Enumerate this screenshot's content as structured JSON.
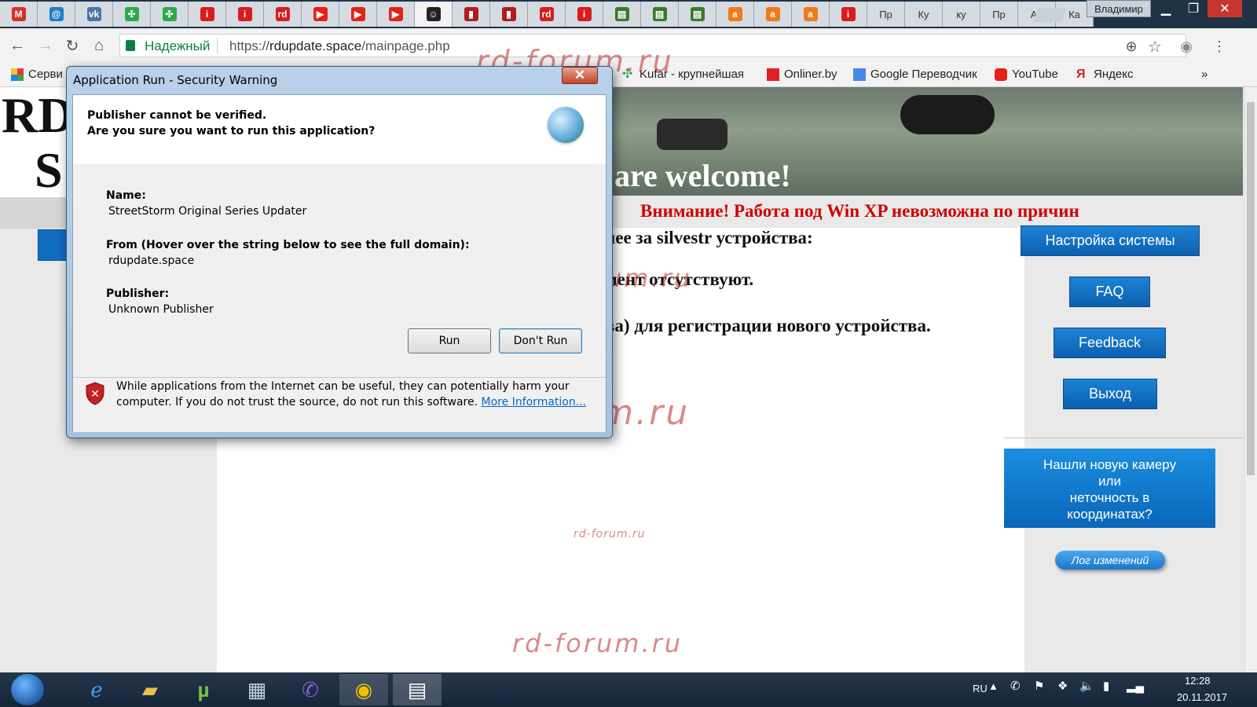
{
  "browser": {
    "tabs": [
      {
        "glyph": "M",
        "color": "#d93025"
      },
      {
        "glyph": "@",
        "color": "#1f7fc4"
      },
      {
        "glyph": "vk",
        "color": "#4a76a8"
      },
      {
        "glyph": "✣",
        "color": "#30a84a"
      },
      {
        "glyph": "✣",
        "color": "#30a84a"
      },
      {
        "glyph": "i",
        "color": "#d91c1c"
      },
      {
        "glyph": "i",
        "color": "#d91c1c"
      },
      {
        "glyph": "rd",
        "color": "#d91c1c"
      },
      {
        "glyph": "▶",
        "color": "#e62117"
      },
      {
        "glyph": "▶",
        "color": "#e62117"
      },
      {
        "glyph": "▶",
        "color": "#e62117"
      },
      {
        "glyph": "☺",
        "color": "#222222"
      },
      {
        "glyph": "▮",
        "color": "#b01c1c"
      },
      {
        "glyph": "▮",
        "color": "#b01c1c"
      },
      {
        "glyph": "rd",
        "color": "#d91c1c"
      },
      {
        "glyph": "i",
        "color": "#d91c1c"
      },
      {
        "glyph": "▤",
        "color": "#3a7a2a"
      },
      {
        "glyph": "▤",
        "color": "#3a7a2a"
      },
      {
        "glyph": "▤",
        "color": "#3a7a2a"
      },
      {
        "glyph": "a",
        "color": "#f07a1a"
      },
      {
        "glyph": "a",
        "color": "#f07a1a"
      },
      {
        "glyph": "a",
        "color": "#f07a1a"
      },
      {
        "glyph": "i",
        "color": "#d91c1c"
      },
      {
        "glyph": "Пр",
        "color": ""
      },
      {
        "glyph": "Ку",
        "color": ""
      },
      {
        "glyph": "ку",
        "color": ""
      },
      {
        "glyph": "Пр",
        "color": ""
      },
      {
        "glyph": "Ан",
        "color": ""
      },
      {
        "glyph": "Ка",
        "color": ""
      }
    ],
    "user_label": "Владимир",
    "secure_label": "Надежный",
    "url_scheme": "https://",
    "url_host": "rdupdate.space",
    "url_path": "/mainpage.php",
    "bookmarks": {
      "services": "Серви",
      "kufar": "Kufar - крупнейшая",
      "onliner": "Onliner.by",
      "translate": "Google Переводчик",
      "youtube": "YouTube",
      "yandex": "Яндекс",
      "more": "»"
    }
  },
  "site": {
    "logo_line1": "RD",
    "logo_line2": "S",
    "hero_text": "are welcome!",
    "warning_banner": "Внимание! Работа под Win XP невозможна по причин",
    "content_line1": "нее за silvestr устройства:",
    "content_line2": "мент отсутствуют.",
    "content_line3": "ва) для регистрации нового устройства.",
    "sidebar": {
      "system_settings": "Настройка системы",
      "faq": "FAQ",
      "feedback": "Feedback",
      "logout": "Выход",
      "camera_line1": "Нашли новую камеру",
      "camera_line2": "или",
      "camera_line3": "неточность в",
      "camera_line4": "координатах?",
      "changelog": "Лог изменений"
    },
    "watermark": "rd-forum.ru"
  },
  "dialog": {
    "title": "Application Run - Security Warning",
    "close": "✕",
    "heading1": "Publisher cannot be verified.",
    "heading2": "Are you sure you want to run this application?",
    "name_label": "Name:",
    "name_value": "StreetStorm Original Series Updater",
    "from_label": "From (Hover over the string below to see the full domain):",
    "from_value": "rdupdate.space",
    "publisher_label": "Publisher:",
    "publisher_value": "Unknown Publisher",
    "run_button": "Run",
    "dont_run_button": "Don't Run",
    "footer_line1": "While applications from the Internet can be useful, they can potentially harm your",
    "footer_line2": "computer. If you do not trust the source, do not run this software.",
    "more_info_link": "More Information..."
  },
  "taskbar": {
    "lang": "RU",
    "time": "12:28",
    "date": "20.11.2017"
  },
  "colors": {
    "accent_blue": "#0f6cbf",
    "warning_red": "#d10000",
    "secure_green": "#0b8043"
  }
}
